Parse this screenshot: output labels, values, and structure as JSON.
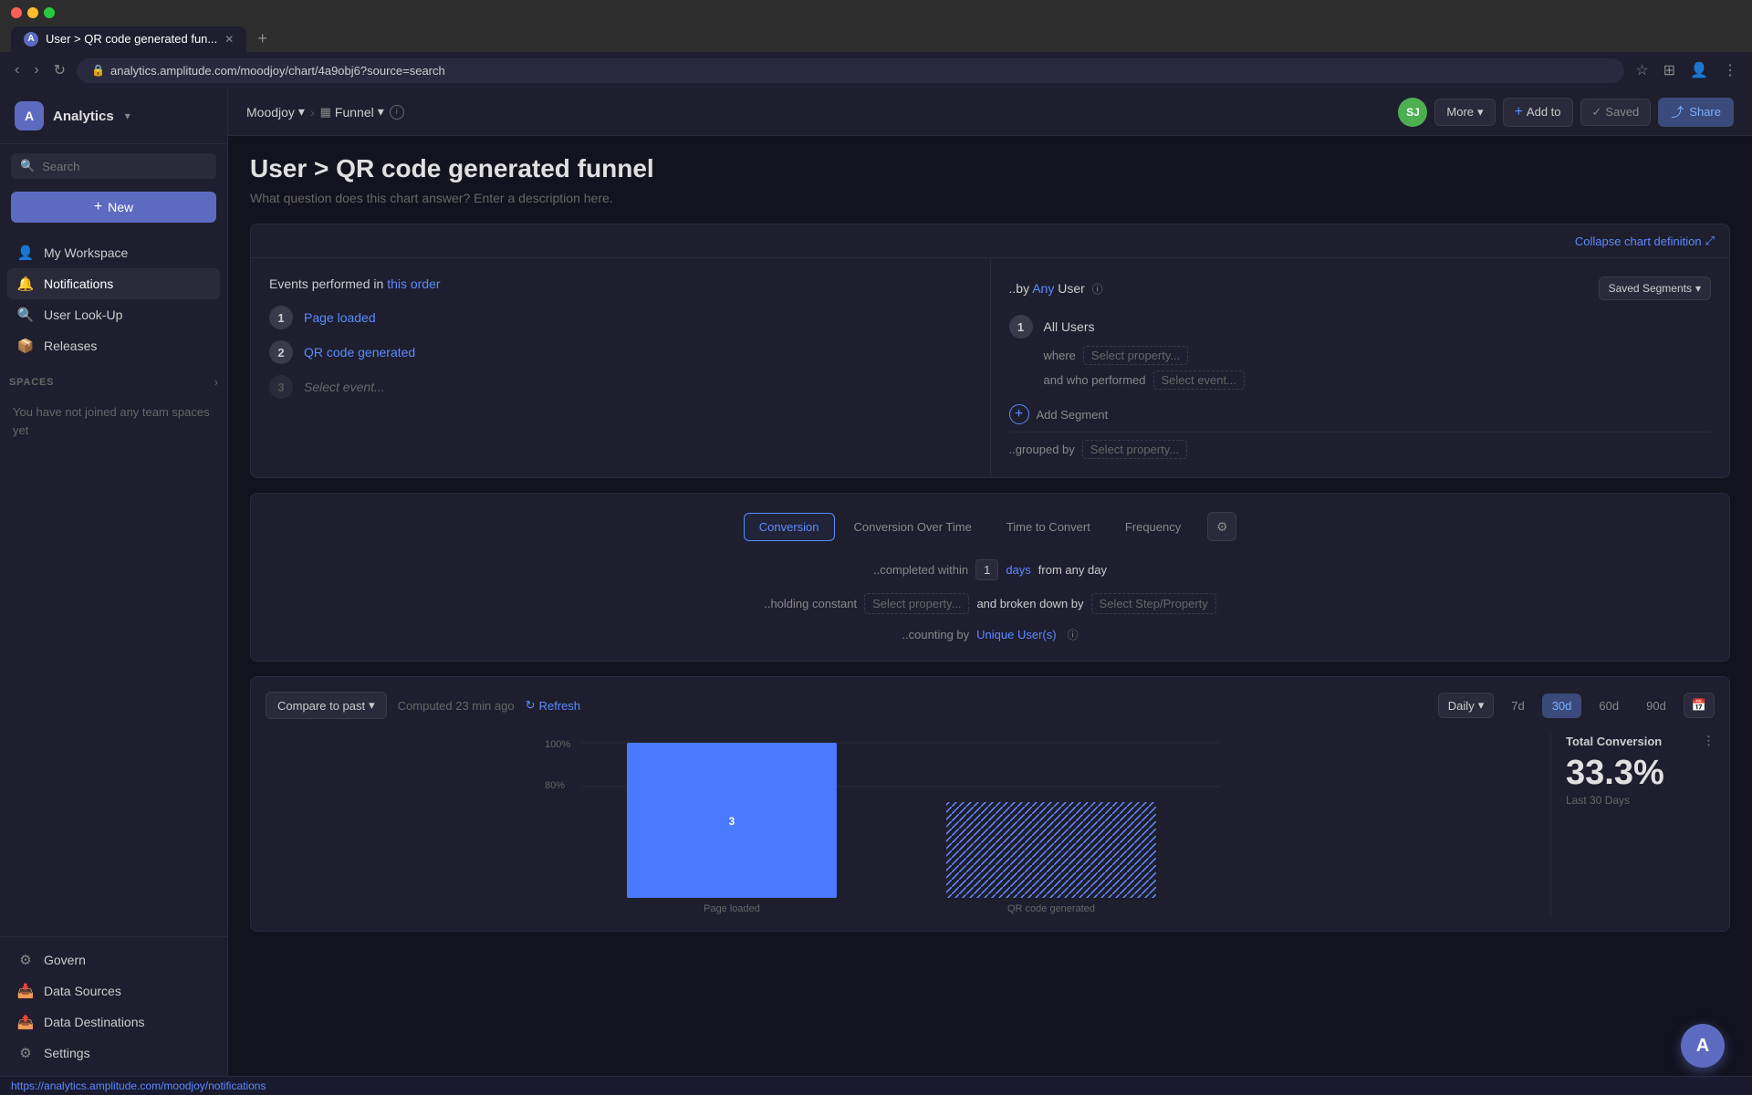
{
  "browser": {
    "tab_title": "User > QR code generated fun...",
    "url": "analytics.amplitude.com/moodjoy/chart/4a9obj6?source=search",
    "new_tab_label": "+",
    "status_bar_url": "https://analytics.amplitude.com/moodjoy/notifications"
  },
  "topbar": {
    "project": "Moodjoy",
    "chart_type": "Funnel",
    "more_label": "More",
    "add_to_label": "Add to",
    "saved_label": "Saved",
    "share_label": "Share",
    "user_initials": "SJ"
  },
  "chart": {
    "title": "User > QR code generated funnel",
    "description": "What question does this chart answer? Enter a description here.",
    "collapse_label": "Collapse chart definition"
  },
  "events_panel": {
    "label": "Events performed in",
    "order_link": "this order",
    "events": [
      {
        "num": "1",
        "name": "Page loaded"
      },
      {
        "num": "2",
        "name": "QR code generated"
      },
      {
        "num": "3",
        "name": "Select event...",
        "placeholder": true
      }
    ]
  },
  "segments_panel": {
    "by_label": "..by",
    "any_label": "Any",
    "user_label": "User",
    "saved_segments_label": "Saved Segments",
    "segments": [
      {
        "num": "1",
        "name": "All Users",
        "where_label": "where",
        "where_select": "Select property...",
        "and_who_label": "and who performed",
        "and_who_select": "Select event..."
      }
    ],
    "add_segment_label": "Add Segment",
    "grouped_by_label": "..grouped by",
    "grouped_select": "Select property..."
  },
  "analysis": {
    "tabs": [
      {
        "label": "Conversion",
        "active": true
      },
      {
        "label": "Conversion Over Time",
        "active": false
      },
      {
        "label": "Time to Convert",
        "active": false
      },
      {
        "label": "Frequency",
        "active": false
      }
    ],
    "completed_within_label": "..completed within",
    "completed_value": "1",
    "completed_unit": "days",
    "from_label": "from any day",
    "holding_constant_label": "..holding constant",
    "holding_select": "Select property...",
    "broken_down_label": "and broken down by",
    "broken_down_select": "Select Step/Property",
    "counting_label": "..counting by",
    "counting_value": "Unique User(s)"
  },
  "results": {
    "compare_label": "Compare to past",
    "computed_label": "Computed 23 min ago",
    "refresh_label": "Refresh",
    "daily_label": "Daily",
    "time_options": [
      "7d",
      "30d",
      "60d",
      "90d"
    ],
    "active_time": "30d",
    "total_conversion_label": "Total Conversion",
    "total_conversion_pct": "33.3%",
    "total_conversion_period": "Last 30 Days",
    "y_axis": [
      "100%",
      "80%"
    ],
    "bar1_label": "3",
    "bar2_label": ""
  },
  "sidebar": {
    "logo_text": "A",
    "app_name": "Analytics",
    "search_placeholder": "Search",
    "new_label": "New",
    "nav_items": [
      {
        "icon": "👤",
        "label": "My Workspace"
      },
      {
        "icon": "🔔",
        "label": "Notifications",
        "active": true
      },
      {
        "icon": "🔍",
        "label": "User Look-Up"
      },
      {
        "icon": "📦",
        "label": "Releases"
      }
    ],
    "spaces_label": "SPACES",
    "spaces_empty": "You have not joined any team spaces yet",
    "bottom_items": [
      {
        "icon": "⚙",
        "label": "Govern"
      },
      {
        "icon": "📥",
        "label": "Data Sources"
      },
      {
        "icon": "📤",
        "label": "Data Destinations"
      },
      {
        "icon": "⚙",
        "label": "Settings"
      }
    ]
  }
}
